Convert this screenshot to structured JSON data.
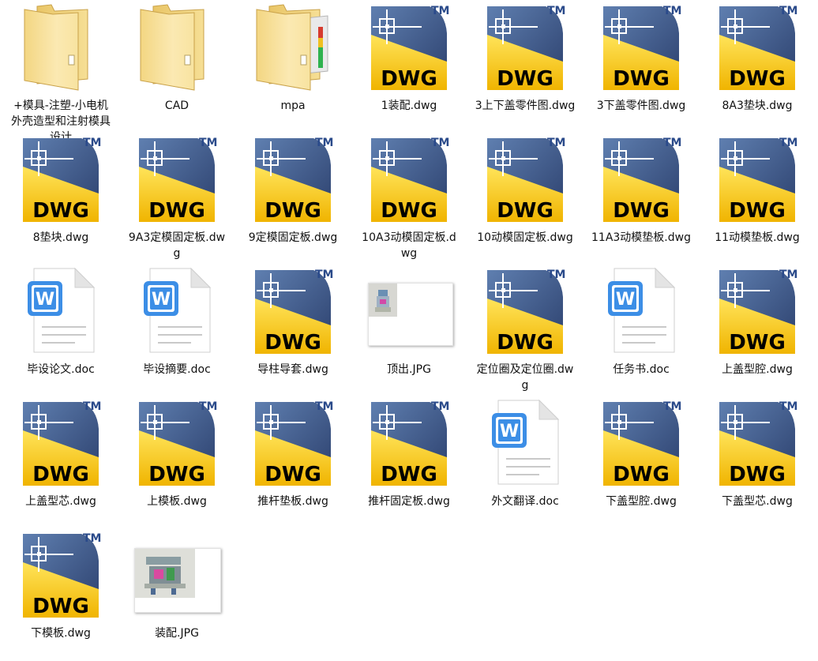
{
  "items": [
    {
      "label": "+模具-注塑-小电机外壳造型和注射模具设计",
      "type": "folder"
    },
    {
      "label": "CAD",
      "type": "folder"
    },
    {
      "label": "mpa",
      "type": "folder-doc"
    },
    {
      "label": "1装配.dwg",
      "type": "dwg",
      "icon_text": "DWG",
      "tm": "TM"
    },
    {
      "label": "3上下盖零件图.dwg",
      "type": "dwg",
      "icon_text": "DWG",
      "tm": "TM"
    },
    {
      "label": "3下盖零件图.dwg",
      "type": "dwg",
      "icon_text": "DWG",
      "tm": "TM"
    },
    {
      "label": "8A3垫块.dwg",
      "type": "dwg",
      "icon_text": "DWG",
      "tm": "TM"
    },
    {
      "label": "8垫块.dwg",
      "type": "dwg",
      "icon_text": "DWG",
      "tm": "TM"
    },
    {
      "label": "9A3定模固定板.dwg",
      "type": "dwg",
      "icon_text": "DWG",
      "tm": "TM"
    },
    {
      "label": "9定模固定板.dwg",
      "type": "dwg",
      "icon_text": "DWG",
      "tm": "TM"
    },
    {
      "label": "10A3动模固定板.dwg",
      "type": "dwg",
      "icon_text": "DWG",
      "tm": "TM"
    },
    {
      "label": "10动模固定板.dwg",
      "type": "dwg",
      "icon_text": "DWG",
      "tm": "TM"
    },
    {
      "label": "11A3动模垫板.dwg",
      "type": "dwg",
      "icon_text": "DWG",
      "tm": "TM"
    },
    {
      "label": "11动模垫板.dwg",
      "type": "dwg",
      "icon_text": "DWG",
      "tm": "TM"
    },
    {
      "label": "毕设论文.doc",
      "type": "doc",
      "icon_text": "W"
    },
    {
      "label": "毕设摘要.doc",
      "type": "doc",
      "icon_text": "W"
    },
    {
      "label": "导柱导套.dwg",
      "type": "dwg",
      "icon_text": "DWG",
      "tm": "TM"
    },
    {
      "label": "顶出.JPG",
      "type": "jpg-top"
    },
    {
      "label": "定位圈及定位圈.dwg",
      "type": "dwg",
      "icon_text": "DWG",
      "tm": "TM"
    },
    {
      "label": "任务书.doc",
      "type": "doc",
      "icon_text": "W"
    },
    {
      "label": "上盖型腔.dwg",
      "type": "dwg",
      "icon_text": "DWG",
      "tm": "TM"
    },
    {
      "label": "上盖型芯.dwg",
      "type": "dwg",
      "icon_text": "DWG",
      "tm": "TM"
    },
    {
      "label": "上模板.dwg",
      "type": "dwg",
      "icon_text": "DWG",
      "tm": "TM"
    },
    {
      "label": "推杆垫板.dwg",
      "type": "dwg",
      "icon_text": "DWG",
      "tm": "TM"
    },
    {
      "label": "推杆固定板.dwg",
      "type": "dwg",
      "icon_text": "DWG",
      "tm": "TM"
    },
    {
      "label": "外文翻译.doc",
      "type": "doc",
      "icon_text": "W"
    },
    {
      "label": "下盖型腔.dwg",
      "type": "dwg",
      "icon_text": "DWG",
      "tm": "TM"
    },
    {
      "label": "下盖型芯.dwg",
      "type": "dwg",
      "icon_text": "DWG",
      "tm": "TM"
    },
    {
      "label": "下模板.dwg",
      "type": "dwg",
      "icon_text": "DWG",
      "tm": "TM"
    },
    {
      "label": "装配.JPG",
      "type": "jpg-asm"
    }
  ]
}
